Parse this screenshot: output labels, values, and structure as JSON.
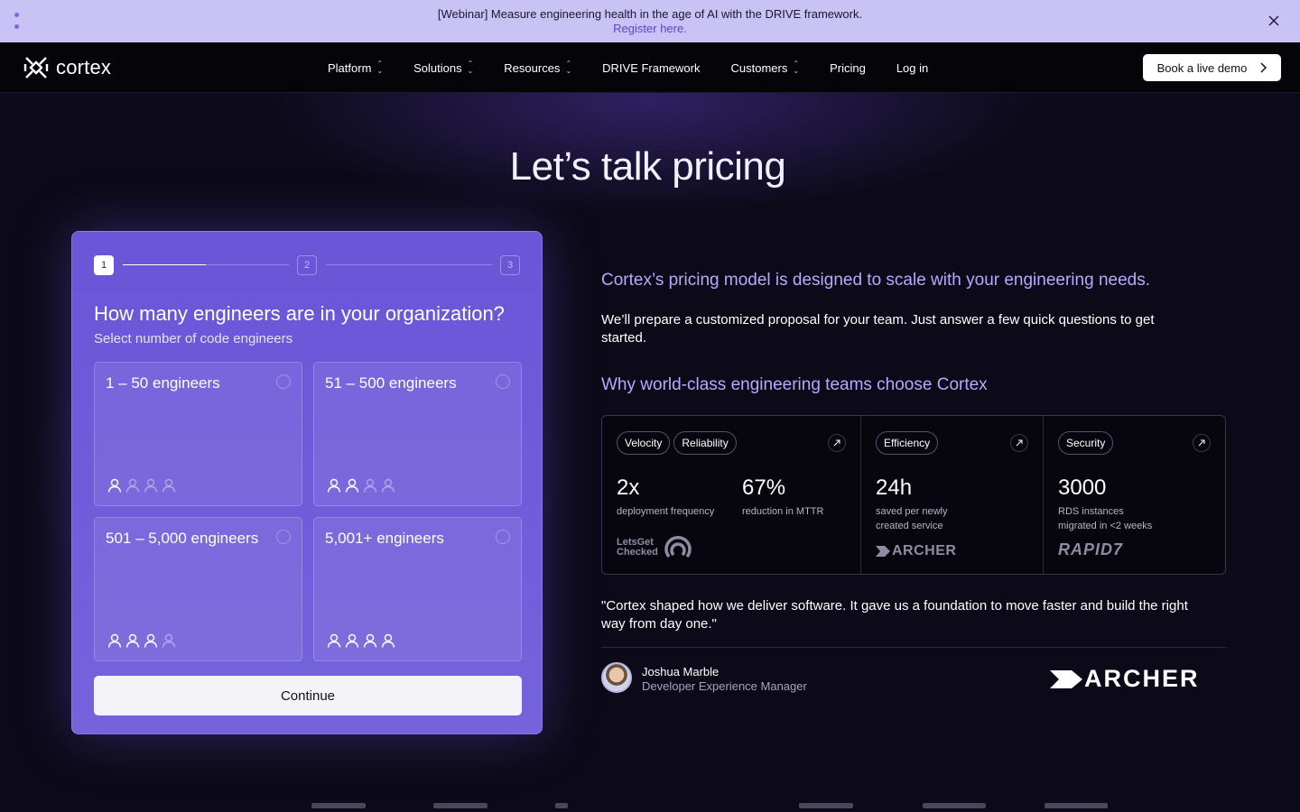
{
  "banner": {
    "text": "[Webinar] Measure engineering health in the age of AI with the DRIVE framework.",
    "link": "Register here."
  },
  "nav": {
    "logo": "cortex",
    "items": [
      {
        "label": "Platform",
        "dropdown": true
      },
      {
        "label": "Solutions",
        "dropdown": true
      },
      {
        "label": "Resources",
        "dropdown": true
      },
      {
        "label": "DRIVE Framework",
        "dropdown": false
      },
      {
        "label": "Customers",
        "dropdown": true
      },
      {
        "label": "Pricing",
        "dropdown": false
      },
      {
        "label": "Log in",
        "dropdown": false
      }
    ],
    "cta": "Book a live demo"
  },
  "hero": {
    "title": "Let’s talk pricing"
  },
  "form": {
    "steps": [
      "1",
      "2",
      "3"
    ],
    "current_step": 1,
    "question": "How many engineers are in your organization?",
    "subtitle": "Select number of code engineers",
    "options": [
      {
        "label": "1 – 50 engineers",
        "filled": 1
      },
      {
        "label": "51 – 500 engineers",
        "filled": 2
      },
      {
        "label": "501 – 5,000 engineers",
        "filled": 3
      },
      {
        "label": "5,001+ engineers",
        "filled": 4
      }
    ],
    "continue_label": "Continue"
  },
  "info": {
    "lead": "Cortex’s pricing model is designed to scale with your engineering needs.",
    "description": "We’ll prepare a customized proposal for your team. Just answer a few quick questions to get started.",
    "why_title": "Why world-class engineering teams choose Cortex"
  },
  "stats": {
    "col1": {
      "tags": [
        "Velocity",
        "Reliability"
      ],
      "metrics": [
        {
          "value": "2x",
          "label": "deployment frequency"
        },
        {
          "value": "67%",
          "label": "reduction in MTTR"
        }
      ],
      "logo_line1": "LetsGet",
      "logo_line2": "Checked"
    },
    "col2": {
      "tags": [
        "Efficiency"
      ],
      "value": "24h",
      "label_line1": "saved per newly",
      "label_line2": "created service",
      "logo": "ARCHER"
    },
    "col3": {
      "tags": [
        "Security"
      ],
      "value": "3000",
      "label_line1": "RDS instances",
      "label_line2": "migrated in <2 weeks",
      "logo": "RAPID7"
    }
  },
  "testimonial": {
    "quote": "\"Cortex shaped how we deliver software. It gave us a foundation to move faster and build the right way from day one.\"",
    "name": "Joshua Marble",
    "role": "Developer Experience Manager",
    "company_logo": "ARCHER"
  },
  "colors": {
    "banner_bg": "#c9c2f5",
    "card_bg": "#6b55d8",
    "accent_text": "#b6a9ff",
    "page_bg": "#0c0a18"
  }
}
